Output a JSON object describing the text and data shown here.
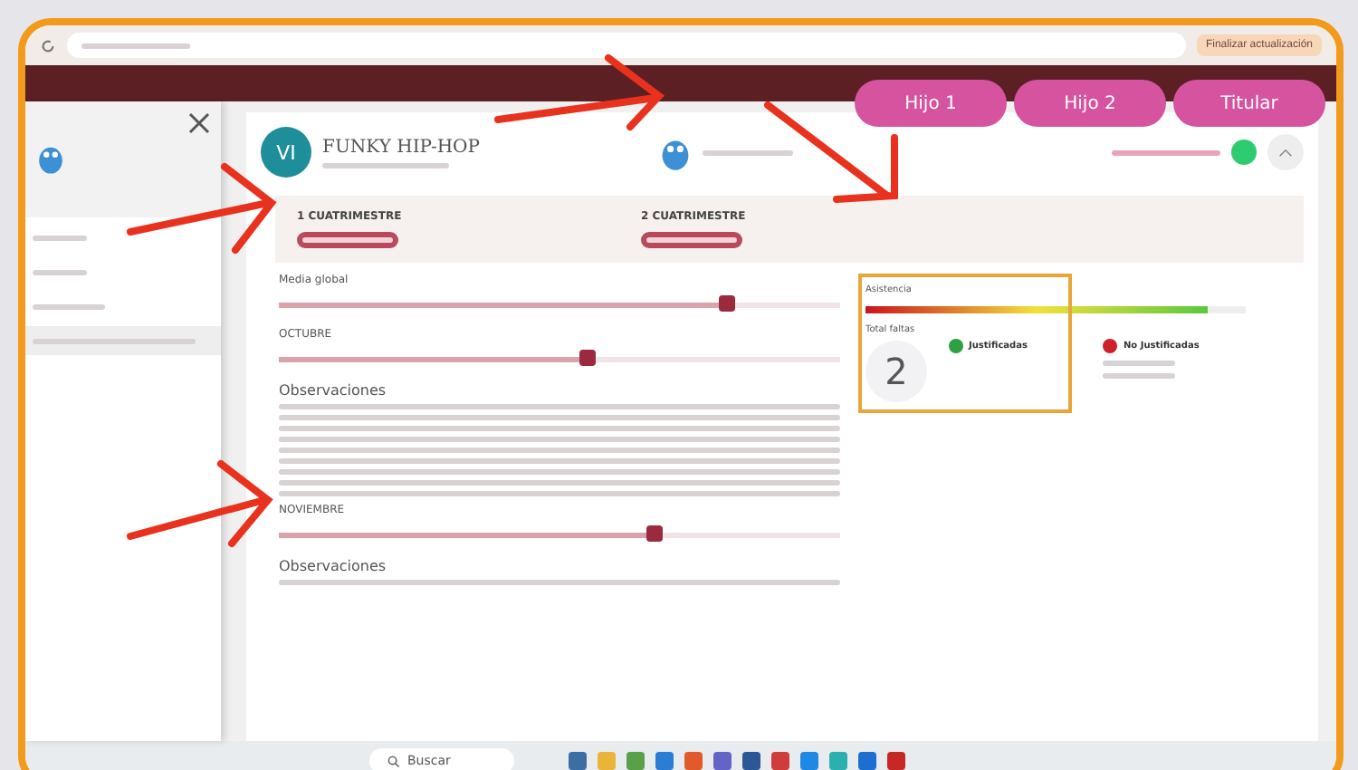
{
  "browser": {
    "action_button": "Finalizar actualización"
  },
  "profile_switch": [
    {
      "label": "Hijo 1"
    },
    {
      "label": "Hijo 2"
    },
    {
      "label": "Titular"
    }
  ],
  "course": {
    "avatar": "VI",
    "title": "FUNKY HIP-HOP"
  },
  "terms": [
    {
      "label": "1 CUATRIMESTRE"
    },
    {
      "label": "2 CUATRIMESTRE"
    }
  ],
  "grades": [
    {
      "kind": "slider",
      "label": "Media global",
      "level": 0.8
    },
    {
      "kind": "slider",
      "label": "OCTUBRE",
      "level": 0.55
    },
    {
      "kind": "notes",
      "label": "Observaciones"
    },
    {
      "kind": "slider",
      "label": "NOVIEMBRE",
      "level": 0.67
    },
    {
      "kind": "notes",
      "label": "Observaciones"
    }
  ],
  "attendance": {
    "title": "Asistencia",
    "level": 0.9,
    "absences_label": "Total faltas",
    "absences": "2",
    "justified": "Justificadas",
    "unjustified": "No Justificadas"
  },
  "sidebar": [
    {
      "selected": false
    },
    {
      "selected": false
    },
    {
      "selected": false
    },
    {
      "selected": true
    }
  ],
  "taskbar": {
    "search": "Buscar"
  }
}
